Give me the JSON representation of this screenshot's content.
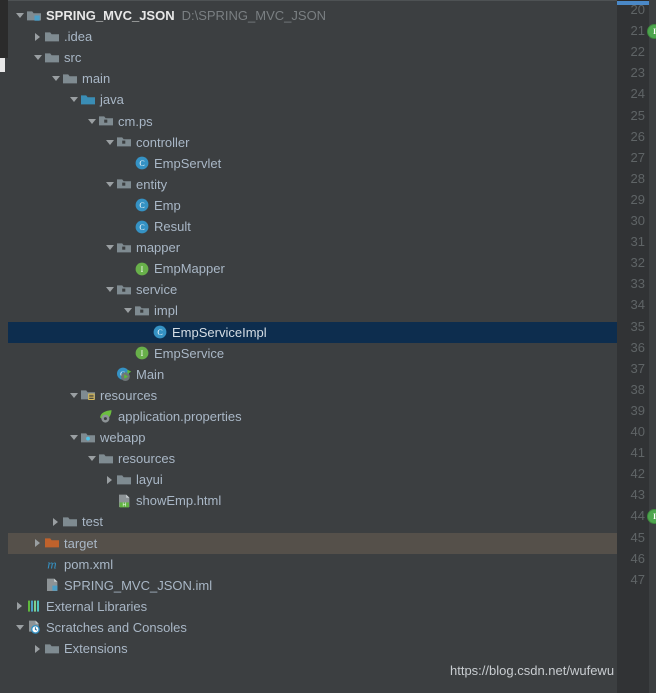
{
  "window": {
    "title": "SPRING_MVC_JSON",
    "project_path": "D:\\SPRING_MVC_JSON"
  },
  "colors": {
    "panel_bg": "#3c3f41",
    "gutter_bg": "#313335",
    "selection_bg": "#0d2d4e",
    "highlight_bg": "#55504a",
    "text": "#a9b7c6",
    "muted_text": "#7a7f82",
    "line_number": "#5f6466",
    "folder_blue": "#7f8b91",
    "folder_orange": "#c0622c",
    "class_blue": "#3592c4",
    "interface_green": "#62b543",
    "accent_blue": "#4a88c7"
  },
  "tree": {
    "rows": [
      {
        "label": "SPRING_MVC_JSON",
        "path": "D:\\SPRING_MVC_JSON",
        "indent": 0,
        "arrow": "down",
        "icon": "project-module-icon",
        "bold": true,
        "state": "normal"
      },
      {
        "label": ".idea",
        "indent": 1,
        "arrow": "right",
        "icon": "folder-icon",
        "state": "normal"
      },
      {
        "label": "src",
        "indent": 1,
        "arrow": "down",
        "icon": "folder-icon",
        "state": "normal"
      },
      {
        "label": "main",
        "indent": 2,
        "arrow": "down",
        "icon": "folder-icon",
        "state": "normal"
      },
      {
        "label": "java",
        "indent": 3,
        "arrow": "down",
        "icon": "source-root-folder-icon",
        "state": "normal"
      },
      {
        "label": "cm.ps",
        "indent": 4,
        "arrow": "down",
        "icon": "package-icon",
        "state": "normal"
      },
      {
        "label": "controller",
        "indent": 5,
        "arrow": "down",
        "icon": "package-icon",
        "state": "normal"
      },
      {
        "label": "EmpServlet",
        "indent": 6,
        "arrow": "none",
        "icon": "java-class-icon",
        "state": "normal"
      },
      {
        "label": "entity",
        "indent": 5,
        "arrow": "down",
        "icon": "package-icon",
        "state": "normal"
      },
      {
        "label": "Emp",
        "indent": 6,
        "arrow": "none",
        "icon": "java-class-icon",
        "state": "normal"
      },
      {
        "label": "Result",
        "indent": 6,
        "arrow": "none",
        "icon": "java-class-icon",
        "state": "normal"
      },
      {
        "label": "mapper",
        "indent": 5,
        "arrow": "down",
        "icon": "package-icon",
        "state": "normal"
      },
      {
        "label": "EmpMapper",
        "indent": 6,
        "arrow": "none",
        "icon": "java-interface-icon",
        "state": "normal"
      },
      {
        "label": "service",
        "indent": 5,
        "arrow": "down",
        "icon": "package-icon",
        "state": "normal"
      },
      {
        "label": "impl",
        "indent": 6,
        "arrow": "down",
        "icon": "package-icon",
        "state": "normal"
      },
      {
        "label": "EmpServiceImpl",
        "indent": 7,
        "arrow": "none",
        "icon": "java-class-icon",
        "state": "selected"
      },
      {
        "label": "EmpService",
        "indent": 6,
        "arrow": "none",
        "icon": "java-interface-icon",
        "state": "normal"
      },
      {
        "label": "Main",
        "indent": 5,
        "arrow": "none",
        "icon": "runnable-class-icon",
        "state": "normal"
      },
      {
        "label": "resources",
        "indent": 3,
        "arrow": "down",
        "icon": "resource-root-folder-icon",
        "state": "normal"
      },
      {
        "label": "application.properties",
        "indent": 4,
        "arrow": "none",
        "icon": "spring-properties-icon",
        "state": "normal"
      },
      {
        "label": "webapp",
        "indent": 3,
        "arrow": "down",
        "icon": "web-root-folder-icon",
        "state": "normal"
      },
      {
        "label": "resources",
        "indent": 4,
        "arrow": "down",
        "icon": "folder-icon",
        "state": "normal"
      },
      {
        "label": "layui",
        "indent": 5,
        "arrow": "right",
        "icon": "folder-icon",
        "state": "normal"
      },
      {
        "label": "showEmp.html",
        "indent": 5,
        "arrow": "none",
        "icon": "html-file-icon",
        "state": "normal"
      },
      {
        "label": "test",
        "indent": 2,
        "arrow": "right",
        "icon": "folder-icon",
        "state": "normal"
      },
      {
        "label": "target",
        "indent": 1,
        "arrow": "right",
        "icon": "excluded-folder-icon",
        "state": "highlighted"
      },
      {
        "label": "pom.xml",
        "indent": 1,
        "arrow": "none",
        "icon": "maven-pom-icon",
        "state": "normal"
      },
      {
        "label": "SPRING_MVC_JSON.iml",
        "indent": 1,
        "arrow": "none",
        "icon": "iml-file-icon",
        "state": "normal"
      },
      {
        "label": "External Libraries",
        "indent": 0,
        "arrow": "right",
        "icon": "libraries-icon",
        "state": "normal"
      },
      {
        "label": "Scratches and Consoles",
        "indent": 0,
        "arrow": "down",
        "icon": "scratches-icon",
        "state": "normal"
      },
      {
        "label": "Extensions",
        "indent": 1,
        "arrow": "right",
        "icon": "folder-icon",
        "state": "normal"
      }
    ]
  },
  "editor_gutter": {
    "line_numbers": [
      20,
      21,
      22,
      23,
      24,
      25,
      26,
      27,
      28,
      29,
      30,
      31,
      32,
      33,
      34,
      35,
      36,
      37,
      38,
      39,
      40,
      41,
      42,
      43,
      44,
      45,
      46,
      47
    ],
    "markers": [
      {
        "line": 21,
        "glyph": "I",
        "name": "implemented-interface-marker"
      },
      {
        "line": 44,
        "glyph": "I",
        "name": "implemented-interface-marker"
      }
    ]
  },
  "watermark": {
    "text": "https://blog.csdn.net/wufewu"
  }
}
